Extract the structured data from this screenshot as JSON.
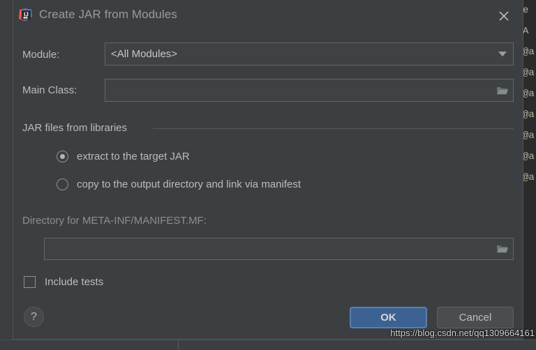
{
  "window": {
    "title": "Create JAR from Modules",
    "app_icon": "intellij-idea-icon",
    "close_icon": "close-icon"
  },
  "form": {
    "module": {
      "label": "Module:",
      "value": "<All Modules>",
      "placeholder": "",
      "arrow_icon": "chevron-down-icon"
    },
    "main_class": {
      "label": "Main Class:",
      "value": "",
      "placeholder": "",
      "browse_icon": "folder-icon"
    },
    "library_group": {
      "title": "JAR files from libraries",
      "options": [
        {
          "label": "extract to the target JAR",
          "selected": true
        },
        {
          "label": "copy to the output directory and link via manifest",
          "selected": false
        }
      ]
    },
    "manifest": {
      "label": "Directory for META-INF/MANIFEST.MF:",
      "value": "",
      "placeholder": "",
      "browse_icon": "folder-icon"
    },
    "include_tests": {
      "label": "Include tests",
      "checked": false
    }
  },
  "buttons": {
    "help": "?",
    "ok": "OK",
    "cancel": "Cancel"
  },
  "colors": {
    "dialog_background": "#3c3f41",
    "ok_button": "#3c6293",
    "ok_button_border": "#5880ae",
    "cancel_button": "#4a4d4f",
    "text": "#bbbbbb",
    "dim_text": "#8c8f91",
    "field_border": "#646769"
  },
  "background": {
    "editor_fragments": [
      "e",
      "A",
      "@a",
      "@a",
      "@a",
      "@a",
      "@a",
      "@a",
      "@a"
    ]
  },
  "watermark": "https://blog.csdn.net/qq1309664161"
}
